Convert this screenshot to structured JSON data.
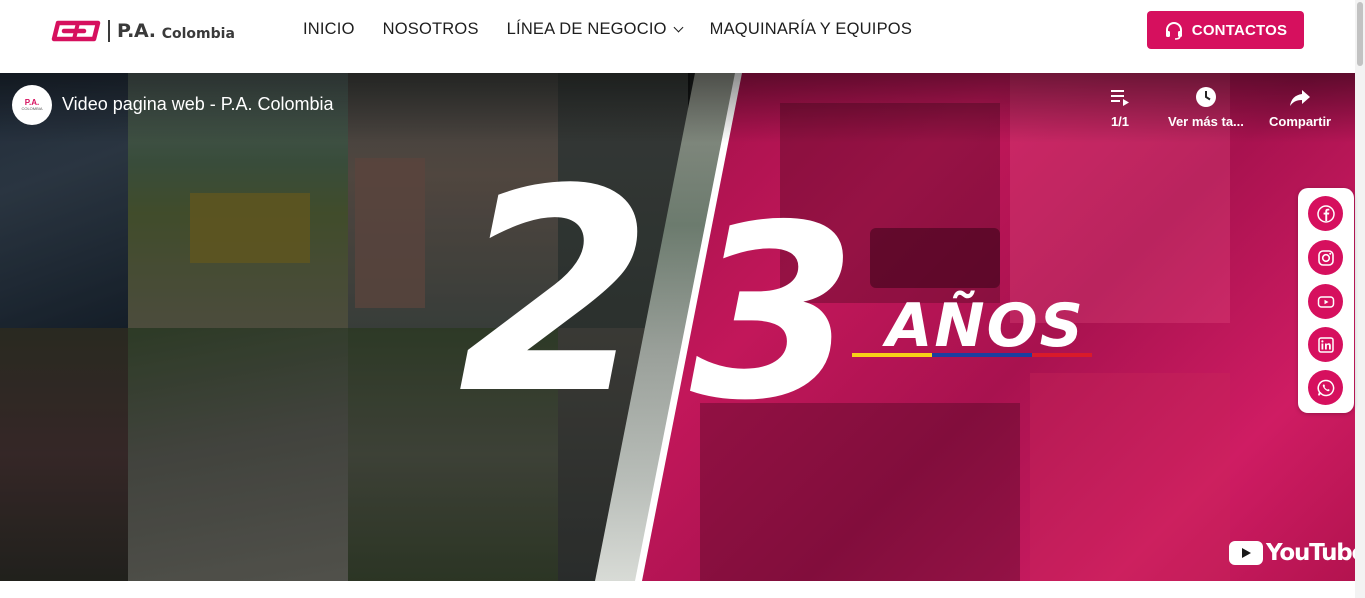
{
  "header": {
    "logo": {
      "name": "P.A.",
      "suffix": "Colombia",
      "mark_icon": "pa-logo-mark",
      "brand_color": "#d6105e"
    },
    "nav": [
      {
        "label": "INICIO",
        "dropdown": false
      },
      {
        "label": "NOSOTROS",
        "dropdown": false
      },
      {
        "label": "LÍNEA DE NEGOCIO",
        "dropdown": true
      },
      {
        "label": "MAQUINARÍA Y EQUIPOS",
        "dropdown": false
      }
    ],
    "contact_button": {
      "label": "CONTACTOS",
      "icon": "headset-icon"
    }
  },
  "video": {
    "channel_avatar_text": "P.A.",
    "channel_avatar_sub": "COLOMBIA",
    "title": "Video pagina web - P.A. Colombia",
    "controls": [
      {
        "icon": "playlist-icon",
        "label": "1/1"
      },
      {
        "icon": "clock-icon",
        "label": "Ver más ta..."
      },
      {
        "icon": "share-icon",
        "label": "Compartir"
      }
    ],
    "overlay": {
      "number_left": "2",
      "number_right": "3",
      "word": "AÑOS"
    },
    "youtube_label": "YouTube"
  },
  "social": [
    {
      "icon": "facebook-icon"
    },
    {
      "icon": "instagram-icon"
    },
    {
      "icon": "youtube-icon"
    },
    {
      "icon": "linkedin-icon"
    },
    {
      "icon": "whatsapp-icon"
    }
  ],
  "colors": {
    "accent": "#d6105e",
    "overlay_magenta": "#c2175a",
    "text_dark": "#1e1e1e"
  }
}
